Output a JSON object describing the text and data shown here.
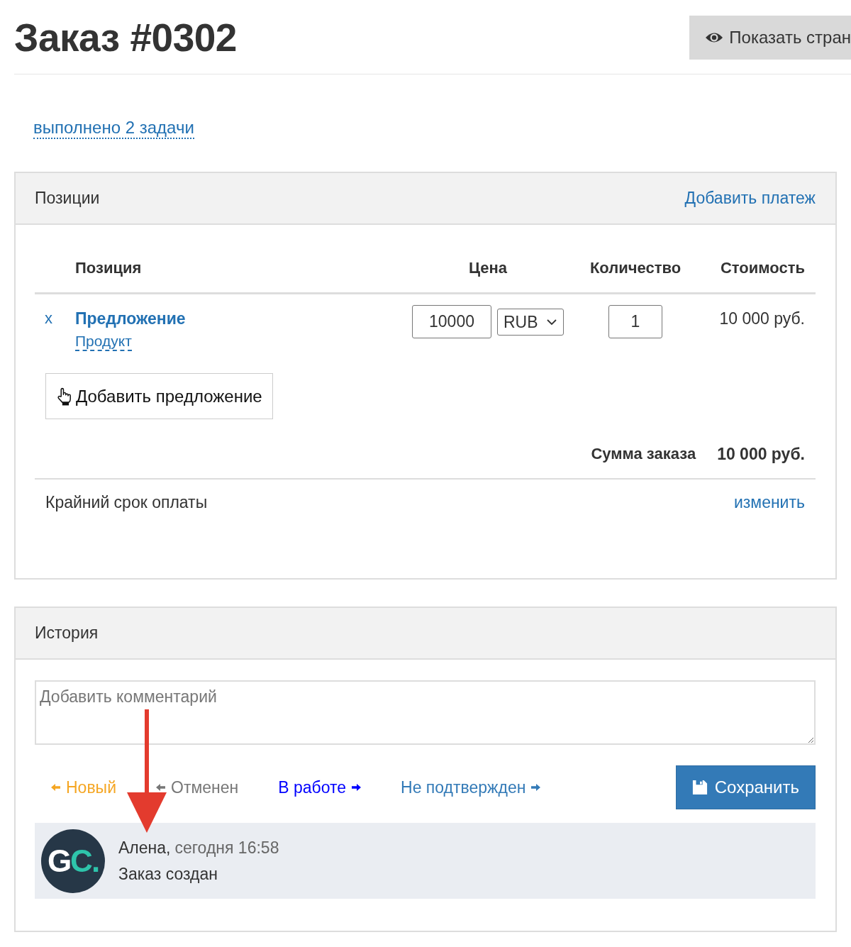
{
  "page": {
    "title": "Заказ #0302",
    "view_button": "Показать стран"
  },
  "tasks_link": "выполнено 2 задачи",
  "positions": {
    "title": "Позиции",
    "add_payment": "Добавить платеж",
    "table": {
      "columns": [
        "Позиция",
        "Цена",
        "Количество",
        "Стоимость"
      ],
      "rows": [
        {
          "remove": "x",
          "name": "Предложение",
          "type": "Продукт",
          "price": "10000",
          "currency": "RUB",
          "quantity": "1",
          "cost": "10 000 руб."
        }
      ]
    },
    "add_button": "Добавить предложение",
    "total": {
      "label": "Сумма заказа",
      "value": "10 000 руб."
    },
    "deadline": {
      "label": "Крайний срок оплаты",
      "action": "изменить"
    }
  },
  "history": {
    "title": "История",
    "comment": {
      "placeholder": "Добавить комментарий"
    },
    "statuses": [
      {
        "label": "Новый",
        "kind": "previous",
        "color": "#f5a623"
      },
      {
        "label": "Отменен",
        "kind": "previous",
        "color": "#777777"
      },
      {
        "label": "В работе",
        "kind": "next",
        "color": "#0000ff"
      },
      {
        "label": "Не подтвержден",
        "kind": "next",
        "color": "#337ab7"
      }
    ],
    "save_button": "Сохранить",
    "entries": [
      {
        "avatar": {
          "letter": "G",
          "accent": "C."
        },
        "author": "Алена,",
        "time": "сегодня 16:58",
        "text": "Заказ создан"
      }
    ]
  },
  "annotations": [
    {
      "kind": "arrow"
    }
  ]
}
